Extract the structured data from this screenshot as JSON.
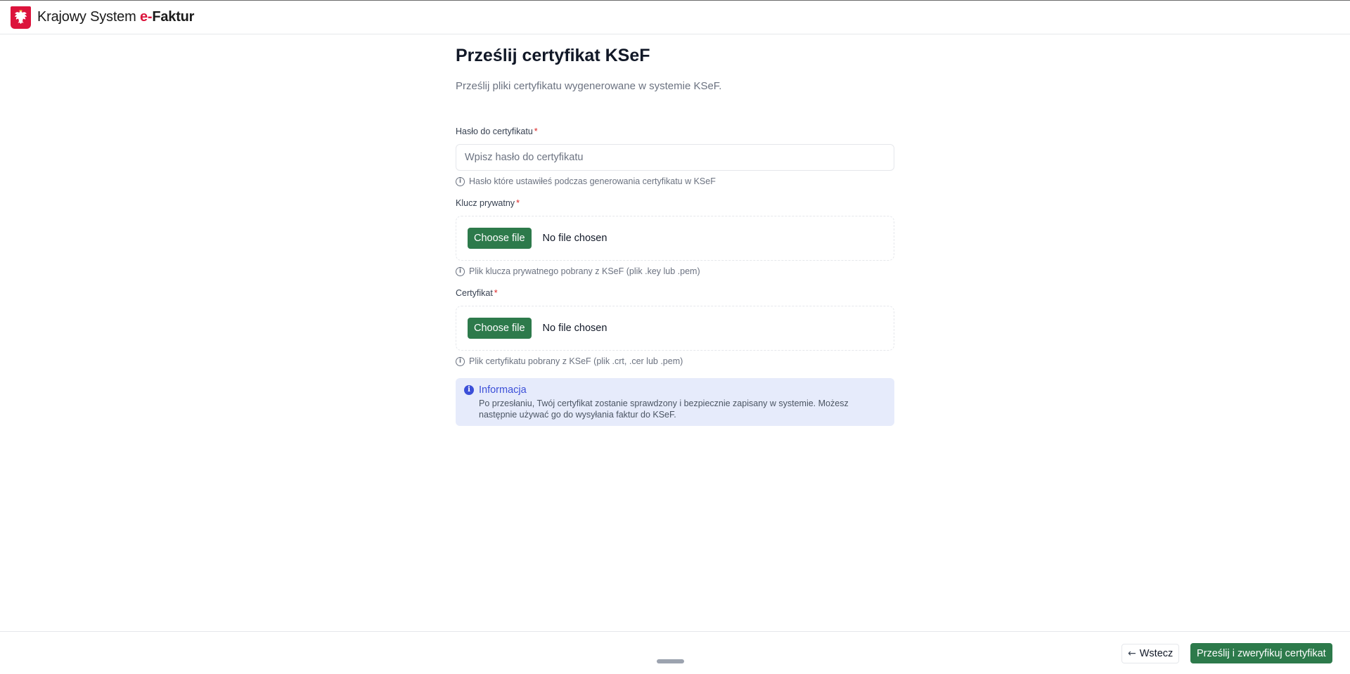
{
  "header": {
    "logo_icon": "polish-eagle-emblem",
    "brand_prefix": "Krajowy System ",
    "brand_e": "e-",
    "brand_faktur": "Faktur",
    "brand_color": "#dc143c"
  },
  "page": {
    "title": "Prześlij certyfikat KSeF",
    "subtitle": "Prześlij pliki certyfikatu wygenerowane w systemie KSeF."
  },
  "form": {
    "password": {
      "label": "Hasło do certyfikatu",
      "required_mark": "*",
      "placeholder": "Wpisz hasło do certyfikatu",
      "value": "",
      "hint": "Hasło które ustawiłeś podczas generowania certyfikatu w KSeF",
      "hint_icon": "info-circle-icon"
    },
    "private_key": {
      "label": "Klucz prywatny",
      "required_mark": "*",
      "button_label": "Choose file",
      "file_status": "No file chosen",
      "hint": "Plik klucza prywatnego pobrany z KSeF (plik .key lub .pem)",
      "hint_icon": "info-circle-icon"
    },
    "certificate": {
      "label": "Certyfikat",
      "required_mark": "*",
      "button_label": "Choose file",
      "file_status": "No file chosen",
      "hint": "Plik certyfikatu pobrany z KSeF (plik .crt, .cer lub .pem)",
      "hint_icon": "info-circle-icon"
    }
  },
  "info": {
    "icon": "info-filled-icon",
    "title": "Informacja",
    "body": "Po przesłaniu, Twój certyfikat zostanie sprawdzony i bezpiecznie zapisany w systemie. Możesz następnie używać go do wysyłania faktur do KSeF."
  },
  "footer": {
    "back_label": "Wstecz",
    "back_icon": "arrow-left-icon",
    "submit_label": "Prześlij i zweryfikuj certyfikat"
  },
  "colors": {
    "primary_green": "#2d7a4b",
    "info_bg": "#e6ebfb",
    "info_accent": "#3b4fd8",
    "required_red": "#dc2626"
  }
}
